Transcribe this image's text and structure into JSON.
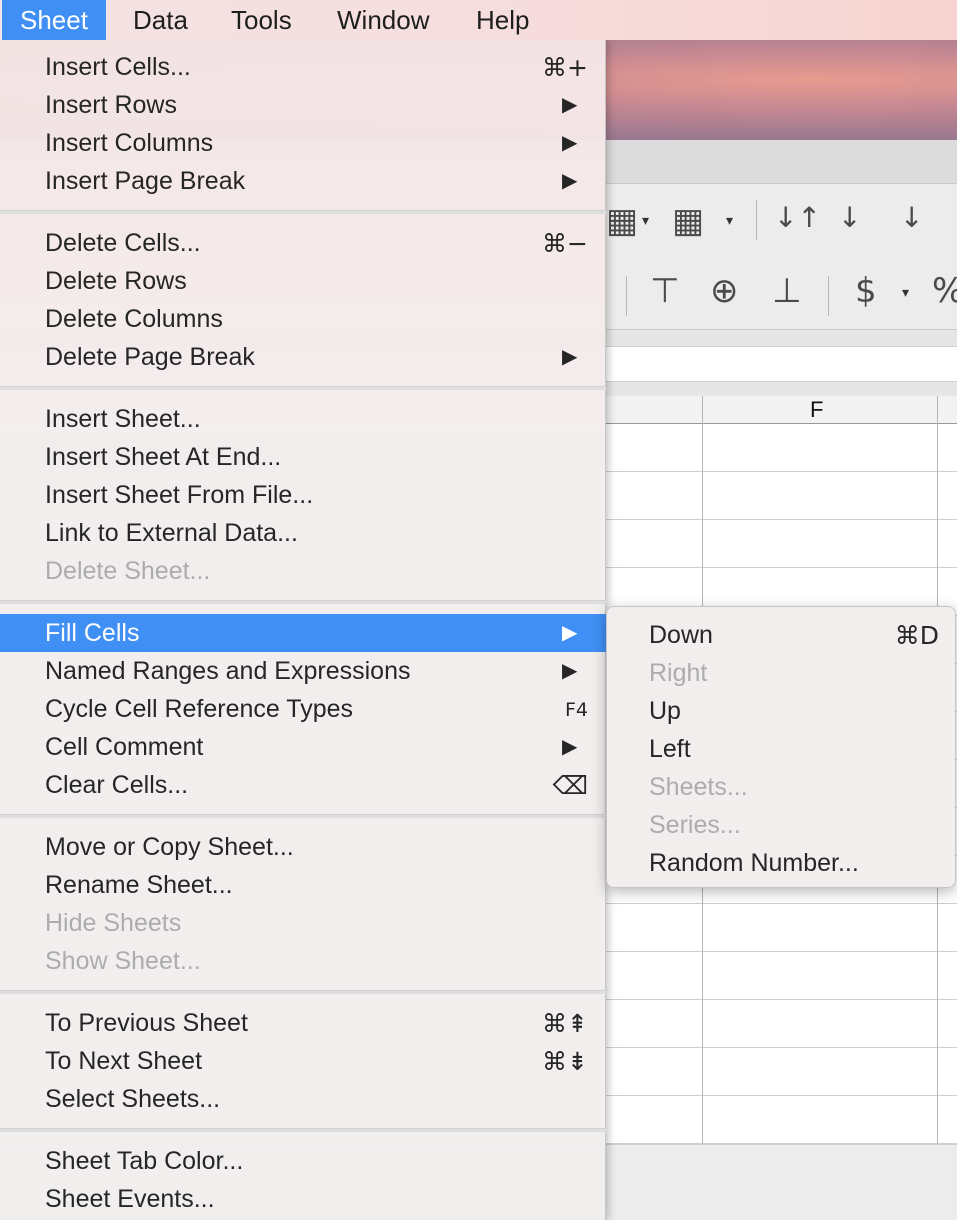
{
  "menubar": {
    "items": [
      {
        "label": "Sheet"
      },
      {
        "label": "Data"
      },
      {
        "label": "Tools"
      },
      {
        "label": "Window"
      },
      {
        "label": "Help"
      }
    ]
  },
  "spreadsheet": {
    "column_label": "F",
    "toolbar_symbols": [
      "$",
      "%"
    ]
  },
  "sheet_menu": {
    "insert_cells": {
      "label": "Insert Cells...",
      "shortcut": "⌘+"
    },
    "insert_rows": {
      "label": "Insert Rows"
    },
    "insert_columns": {
      "label": "Insert Columns"
    },
    "insert_page_break": {
      "label": "Insert Page Break"
    },
    "delete_cells": {
      "label": "Delete Cells...",
      "shortcut": "⌘−"
    },
    "delete_rows": {
      "label": "Delete Rows"
    },
    "delete_columns": {
      "label": "Delete Columns"
    },
    "delete_page_break": {
      "label": "Delete Page Break"
    },
    "insert_sheet": {
      "label": "Insert Sheet..."
    },
    "insert_sheet_at_end": {
      "label": "Insert Sheet At End..."
    },
    "insert_sheet_from_file": {
      "label": "Insert Sheet From File..."
    },
    "link_external": {
      "label": "Link to External Data..."
    },
    "delete_sheet": {
      "label": "Delete Sheet..."
    },
    "fill_cells": {
      "label": "Fill Cells"
    },
    "named_ranges": {
      "label": "Named Ranges and Expressions"
    },
    "cycle_refs": {
      "label": "Cycle Cell Reference Types",
      "shortcut": "F4"
    },
    "cell_comment": {
      "label": "Cell Comment"
    },
    "clear_cells": {
      "label": "Clear Cells...",
      "shortcut": "⌫"
    },
    "move_copy": {
      "label": "Move or Copy Sheet..."
    },
    "rename_sheet": {
      "label": "Rename Sheet..."
    },
    "hide_sheets": {
      "label": "Hide Sheets"
    },
    "show_sheet": {
      "label": "Show Sheet..."
    },
    "prev_sheet": {
      "label": "To Previous Sheet",
      "shortcut": "⌘⇞"
    },
    "next_sheet": {
      "label": "To Next Sheet",
      "shortcut": "⌘⇟"
    },
    "select_sheets": {
      "label": "Select Sheets..."
    },
    "tab_color": {
      "label": "Sheet Tab Color..."
    },
    "sheet_events": {
      "label": "Sheet Events..."
    }
  },
  "fill_submenu": {
    "down": {
      "label": "Down",
      "shortcut": "⌘D"
    },
    "right": {
      "label": "Right"
    },
    "up": {
      "label": "Up"
    },
    "left": {
      "label": "Left"
    },
    "sheets": {
      "label": "Sheets..."
    },
    "series": {
      "label": "Series..."
    },
    "random": {
      "label": "Random Number..."
    }
  },
  "colors": {
    "highlight": "#3f8ff4",
    "disabled_text": "#acacac",
    "text": "#262626"
  }
}
